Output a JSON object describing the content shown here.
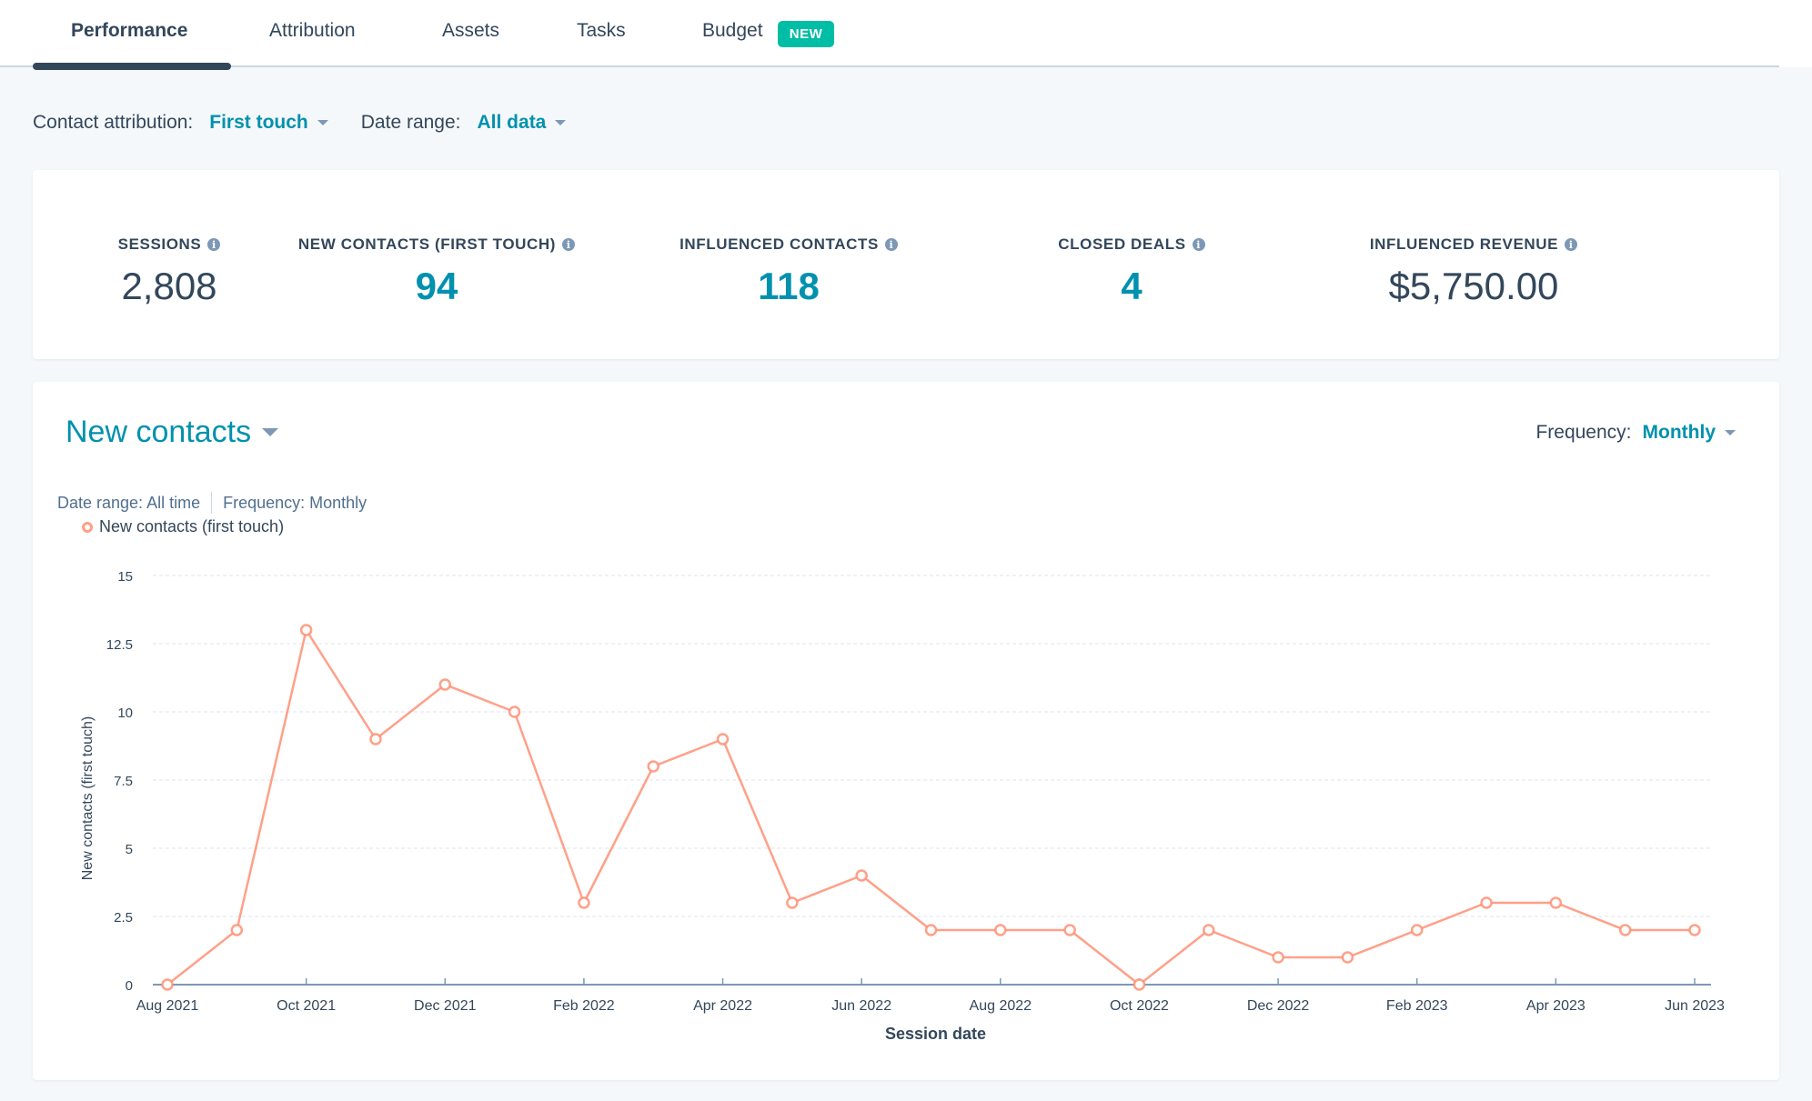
{
  "tabs": [
    {
      "label": "Performance",
      "active": true
    },
    {
      "label": "Attribution",
      "active": false
    },
    {
      "label": "Assets",
      "active": false
    },
    {
      "label": "Tasks",
      "active": false
    },
    {
      "label": "Budget",
      "active": false,
      "badge": "NEW"
    }
  ],
  "filters": {
    "contact_attribution": {
      "label": "Contact attribution:",
      "value": "First touch"
    },
    "date_range": {
      "label": "Date range:",
      "value": "All data"
    }
  },
  "stats": [
    {
      "label": "SESSIONS",
      "value": "2,808",
      "link": false
    },
    {
      "label": "NEW CONTACTS (FIRST TOUCH)",
      "value": "94",
      "link": true
    },
    {
      "label": "INFLUENCED CONTACTS",
      "value": "118",
      "link": true
    },
    {
      "label": "CLOSED DEALS",
      "value": "4",
      "link": true
    },
    {
      "label": "INFLUENCED REVENUE",
      "value": "$5,750.00",
      "link": false
    }
  ],
  "chart_panel": {
    "title": "New contacts",
    "frequency_label": "Frequency:",
    "frequency_value": "Monthly",
    "meta_date_range": "Date range: All time",
    "meta_frequency": "Frequency: Monthly",
    "legend_label": "New contacts (first touch)"
  },
  "colors": {
    "accent": "#0091ae",
    "text": "#33475b",
    "series": "#ff8f73",
    "badge": "#00bda5"
  },
  "chart_data": {
    "type": "line",
    "title": "New contacts",
    "xlabel": "Session date",
    "ylabel": "New contacts (first touch)",
    "ylim": [
      0,
      15
    ],
    "yticks": [
      0,
      2.5,
      5,
      7.5,
      10,
      12.5,
      15
    ],
    "ytick_labels": [
      "0",
      "2.5",
      "5",
      "7.5",
      "10",
      "12.5",
      "15"
    ],
    "grid": true,
    "legend": "top-left",
    "x": [
      "Aug 2021",
      "Sep 2021",
      "Oct 2021",
      "Nov 2021",
      "Dec 2021",
      "Jan 2022",
      "Feb 2022",
      "Mar 2022",
      "Apr 2022",
      "May 2022",
      "Jun 2022",
      "Jul 2022",
      "Aug 2022",
      "Sep 2022",
      "Oct 2022",
      "Nov 2022",
      "Dec 2022",
      "Jan 2023",
      "Feb 2023",
      "Mar 2023",
      "Apr 2023",
      "May 2023",
      "Jun 2023"
    ],
    "xtick_labels": [
      "Aug 2021",
      "Oct 2021",
      "Dec 2021",
      "Feb 2022",
      "Apr 2022",
      "Jun 2022",
      "Aug 2022",
      "Oct 2022",
      "Dec 2022",
      "Feb 2023",
      "Apr 2023",
      "Jun 2023"
    ],
    "series": [
      {
        "name": "New contacts (first touch)",
        "values": [
          0,
          2,
          13,
          9,
          11,
          10,
          3,
          8,
          9,
          3,
          4,
          2,
          2,
          2,
          0,
          2,
          1,
          1,
          2,
          3,
          3,
          2,
          2
        ]
      }
    ]
  }
}
